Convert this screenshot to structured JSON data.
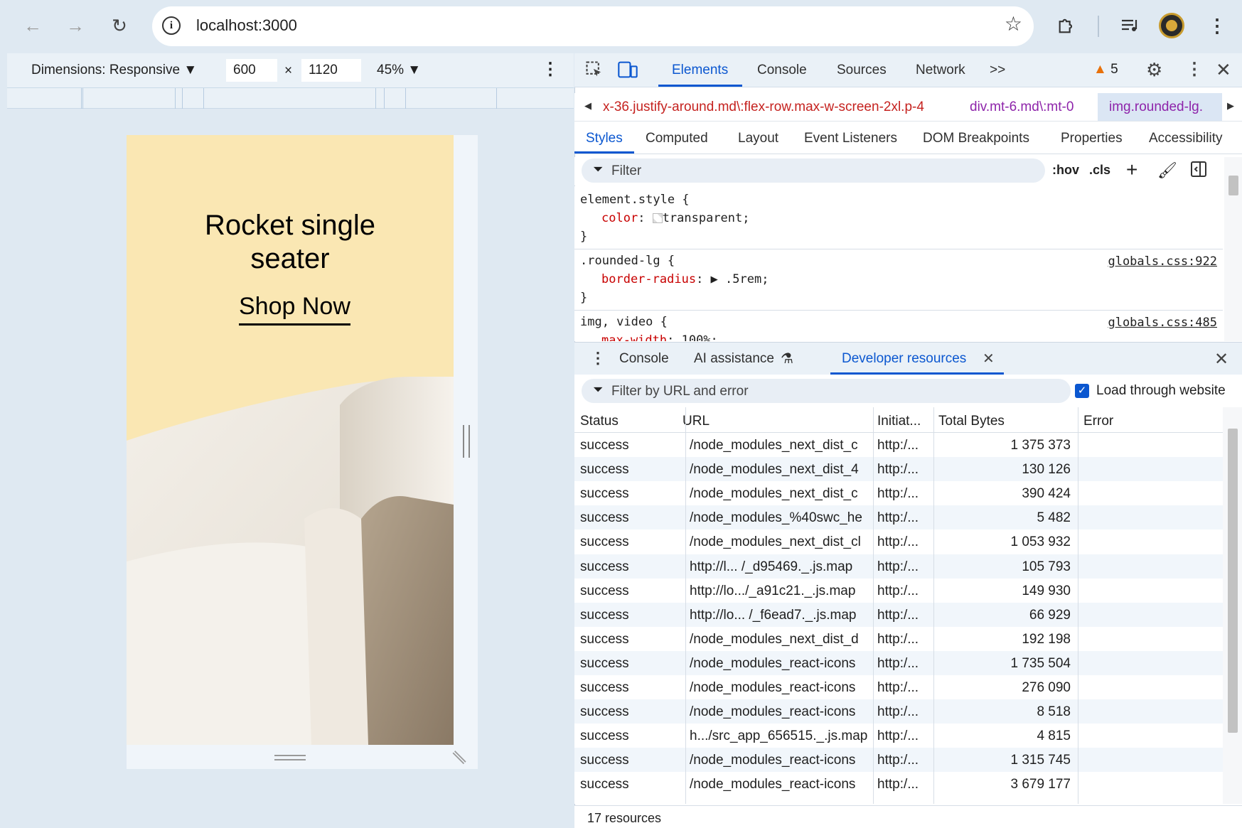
{
  "browser": {
    "url": "localhost:3000",
    "icons": {
      "back": "arrow-left-icon",
      "forward": "arrow-right-icon",
      "reload": "reload-icon",
      "info": "info-icon",
      "star": "star-icon",
      "extensions": "puzzle-icon",
      "media": "media-queue-icon",
      "profile": "avatar",
      "menu": "kebab-menu-icon"
    }
  },
  "device_toolbar": {
    "dimensions_label": "Dimensions: Responsive ▼",
    "width": "600",
    "times": "×",
    "height": "1120",
    "zoom": "45% ▼"
  },
  "preview": {
    "title_line1": "Rocket single",
    "title_line2": "seater",
    "cta": "Shop Now",
    "background_color": "#fae7b3"
  },
  "devtools": {
    "tabs": [
      "Elements",
      "Console",
      "Sources",
      "Network",
      ">>"
    ],
    "active_tab": "Elements",
    "warnings": "5",
    "breadcrumbs": [
      "x-36.justify-around.md\\:flex-row.max-w-screen-2xl.p-4",
      "div.mt-6.md\\:mt-0",
      "img.rounded-lg."
    ],
    "style_tabs": [
      "Styles",
      "Computed",
      "Layout",
      "Event Listeners",
      "DOM Breakpoints",
      "Properties",
      "Accessibility"
    ],
    "filter_placeholder": "Filter",
    "hov": ":hov",
    "cls": ".cls",
    "rules": [
      {
        "selector": "element.style {",
        "prop": "color",
        "value": "transparent;",
        "close": "}",
        "source": ""
      },
      {
        "selector": ".rounded-lg {",
        "prop": "border-radius",
        "value": "▶ .5rem;",
        "close": "}",
        "source": "globals.css:922"
      },
      {
        "selector": "img, video {",
        "prop": "max-width",
        "value": "100%;",
        "close": "",
        "source": "globals.css:485"
      }
    ]
  },
  "drawer": {
    "tabs": [
      "Console",
      "AI assistance",
      "Developer resources"
    ],
    "active_tab": "Developer resources",
    "filter_placeholder": "Filter by URL and error",
    "load_through_website": "Load through website",
    "columns": [
      "Status",
      "URL",
      "Initiat...",
      "Total Bytes",
      "Error"
    ],
    "rows": [
      {
        "status": "success",
        "url": "/node_modules_next_dist_c",
        "initiator": "http:/...",
        "bytes": "1 375 373",
        "error": ""
      },
      {
        "status": "success",
        "url": "/node_modules_next_dist_4",
        "initiator": "http:/...",
        "bytes": "130 126",
        "error": ""
      },
      {
        "status": "success",
        "url": "/node_modules_next_dist_c",
        "initiator": "http:/...",
        "bytes": "390 424",
        "error": ""
      },
      {
        "status": "success",
        "url": "/node_modules_%40swc_he",
        "initiator": "http:/...",
        "bytes": "5 482",
        "error": ""
      },
      {
        "status": "success",
        "url": "/node_modules_next_dist_cl",
        "initiator": "http:/...",
        "bytes": "1 053 932",
        "error": ""
      },
      {
        "status": "success",
        "url": "http://l...  /_d95469._.js.map",
        "initiator": "http:/...",
        "bytes": "105 793",
        "error": ""
      },
      {
        "status": "success",
        "url": "http://lo.../_a91c21._.js.map",
        "initiator": "http:/...",
        "bytes": "149 930",
        "error": ""
      },
      {
        "status": "success",
        "url": "http://lo... /_f6ead7._.js.map",
        "initiator": "http:/...",
        "bytes": "66 929",
        "error": ""
      },
      {
        "status": "success",
        "url": "/node_modules_next_dist_d",
        "initiator": "http:/...",
        "bytes": "192 198",
        "error": ""
      },
      {
        "status": "success",
        "url": "/node_modules_react-icons",
        "initiator": "http:/...",
        "bytes": "1 735 504",
        "error": ""
      },
      {
        "status": "success",
        "url": "/node_modules_react-icons",
        "initiator": "http:/...",
        "bytes": "276 090",
        "error": ""
      },
      {
        "status": "success",
        "url": "/node_modules_react-icons",
        "initiator": "http:/...",
        "bytes": "8 518",
        "error": ""
      },
      {
        "status": "success",
        "url": "h.../src_app_656515._.js.map",
        "initiator": "http:/...",
        "bytes": "4 815",
        "error": ""
      },
      {
        "status": "success",
        "url": "/node_modules_react-icons",
        "initiator": "http:/...",
        "bytes": "1 315 745",
        "error": ""
      },
      {
        "status": "success",
        "url": "/node_modules_react-icons",
        "initiator": "http:/...",
        "bytes": "3 679 177",
        "error": ""
      }
    ],
    "footer": "17 resources"
  },
  "colors": {
    "accent": "#0b57d0",
    "warning": "#e8710a",
    "css_prop": "#c80000",
    "breadcrumb": "#c5221f"
  }
}
